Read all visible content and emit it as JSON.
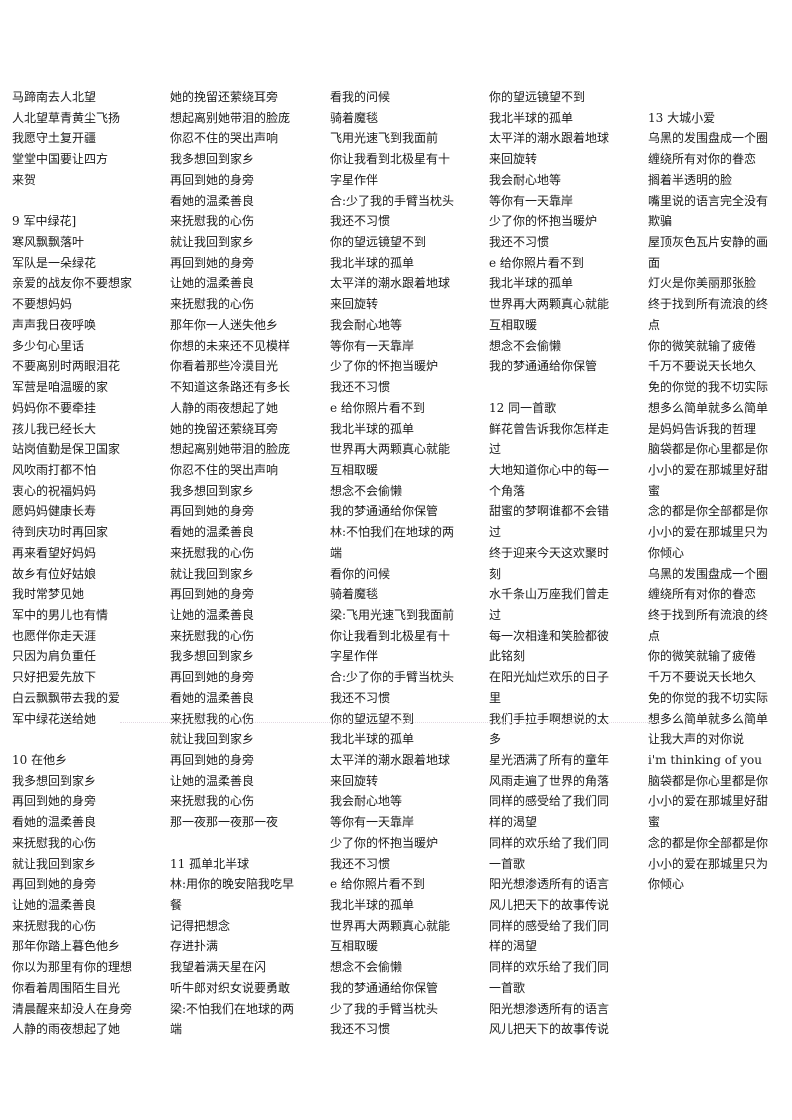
{
  "document": {
    "columns": [
      {
        "lines": [
          "马蹄南去人北望",
          "人北望草青黄尘飞扬",
          "我愿守土复开疆",
          "堂堂中国要让四方",
          "来贺",
          "",
          "9 军中绿花]",
          "寒风飘飘落叶",
          "军队是一朵绿花",
          "亲爱的战友你不要想家",
          "不要想妈妈",
          "声声我日夜呼唤",
          "多少句心里话",
          "不要离别时两眼泪花",
          "军营是咱温暖的家",
          "妈妈你不要牵挂",
          "孩儿我已经长大",
          "站岗值勤是保卫国家",
          "风吹雨打都不怕",
          "衷心的祝福妈妈",
          "愿妈妈健康长寿",
          "待到庆功时再回家",
          "再来看望好妈妈",
          "故乡有位好姑娘",
          "我时常梦见她",
          "军中的男儿也有情",
          "也愿伴你走天涯",
          "只因为肩负重任",
          "只好把爱先放下",
          "白云飘飘带去我的爱",
          "军中绿花送给她",
          "",
          "10 在他乡",
          "我多想回到家乡",
          "再回到她的身旁",
          "看她的温柔善良",
          "来抚慰我的心伤",
          "就让我回到家乡",
          "再回到她的身旁",
          "让她的温柔善良",
          "来抚慰我的心伤",
          "那年你踏上暮色他乡",
          "你以为那里有你的理想",
          "你看着周围陌生目光",
          "清晨醒来却没人在身旁",
          "人静的雨夜想起了她"
        ]
      },
      {
        "lines": [
          "她的挽留还萦绕耳旁",
          "想起离别她带泪的脸庞",
          "你忍不住的哭出声响",
          "我多想回到家乡",
          "再回到她的身旁",
          "看她的温柔善良",
          "来抚慰我的心伤",
          "就让我回到家乡",
          "再回到她的身旁",
          "让她的温柔善良",
          "来抚慰我的心伤",
          "那年你一人迷失他乡",
          "你想的未来还不见模样",
          "你看着那些冷漠目光",
          "不知道这条路还有多长",
          "人静的雨夜想起了她",
          "她的挽留还萦绕耳旁",
          "想起离别她带泪的脸庞",
          "你忍不住的哭出声响",
          "我多想回到家乡",
          "再回到她的身旁",
          "看她的温柔善良",
          "来抚慰我的心伤",
          "就让我回到家乡",
          "再回到她的身旁",
          "让她的温柔善良",
          "来抚慰我的心伤",
          "我多想回到家乡",
          "再回到她的身旁",
          "看她的温柔善良",
          "来抚慰我的心伤",
          "就让我回到家乡",
          "再回到她的身旁",
          "让她的温柔善良",
          "来抚慰我的心伤",
          "那一夜那一夜那一夜",
          "",
          "11 孤单北半球",
          "林:用你的晚安陪我吃早",
          "餐",
          "记得把想念",
          "存进扑满",
          "我望着满天星在闪",
          "听牛郎对织女说要勇敢",
          "梁:不怕我们在地球的两",
          "端"
        ]
      },
      {
        "lines": [
          "看我的问候",
          "骑着魔毯",
          "飞用光速飞到我面前",
          "你让我看到北极星有十",
          "字星作伴",
          "合:少了我的手臂当枕头",
          "我还不习惯",
          "你的望远镜望不到",
          "我北半球的孤单",
          "太平洋的潮水跟着地球",
          "来回旋转",
          "我会耐心地等",
          "等你有一天靠岸",
          "少了你的怀抱当暖炉",
          "我还不习惯",
          "e 给你照片看不到",
          "我北半球的孤单",
          "世界再大两颗真心就能",
          "互相取暖",
          "想念不会偷懒",
          "我的梦通通给你保管",
          "林:不怕我们在地球的两",
          "端",
          "看你的问候",
          "骑着魔毯",
          "梁:飞用光速飞到我面前",
          "你让我看到北极星有十",
          "字星作伴",
          "合:少了你的手臂当枕头",
          "我还不习惯",
          "你的望远望不到",
          "我北半球的孤单",
          "太平洋的潮水跟着地球",
          "来回旋转",
          "我会耐心地等",
          "等你有一天靠岸",
          "少了你的怀抱当暖炉",
          "我还不习惯",
          "e 给你照片看不到",
          "我北半球的孤单",
          "世界再大两颗真心就能",
          "互相取暖",
          "想念不会偷懒",
          "我的梦通通给你保管",
          "少了我的手臂当枕头",
          "我还不习惯"
        ]
      },
      {
        "lines": [
          "你的望远镜望不到",
          "我北半球的孤单",
          "太平洋的潮水跟着地球",
          "来回旋转",
          "我会耐心地等",
          "等你有一天靠岸",
          "少了你的怀抱当暖炉",
          "我还不习惯",
          "e 给你照片看不到",
          "我北半球的孤单",
          "世界再大两颗真心就能",
          "互相取暖",
          "想念不会偷懒",
          "我的梦通通给你保管",
          "",
          "12 同一首歌",
          "鲜花曾告诉我你怎样走",
          "过",
          "大地知道你心中的每一",
          "个角落",
          "甜蜜的梦啊谁都不会错",
          "过",
          "终于迎来今天这欢聚时",
          "刻",
          "水千条山万座我们曾走",
          "过",
          "每一次相逢和笑脸都彼",
          "此铭刻",
          "在阳光灿烂欢乐的日子",
          "里",
          "我们手拉手啊想说的太",
          "多",
          "星光洒满了所有的童年",
          "风雨走遍了世界的角落",
          "同样的感受给了我们同",
          "样的渴望",
          "同样的欢乐给了我们同",
          "一首歌",
          "阳光想渗透所有的语言",
          "风儿把天下的故事传说",
          "同样的感受给了我们同",
          "样的渴望",
          "同样的欢乐给了我们同",
          "一首歌",
          "阳光想渗透所有的语言",
          "风儿把天下的故事传说"
        ]
      },
      {
        "lines": [
          "",
          "13 大城小爱",
          "乌黑的发围盘成一个圈",
          "缠绕所有对你的眷恋",
          "搁着半透明的脸",
          "嘴里说的语言完全没有",
          "欺骗",
          "屋顶灰色瓦片安静的画",
          "面",
          "灯火是你美丽那张脸",
          "终于找到所有流浪的终",
          "点",
          "你的微笑就输了疲倦",
          "千万不要说天长地久",
          "免的你觉的我不切实际",
          "想多么简单就多么简单",
          "是妈妈告诉我的哲理",
          "脑袋都是你心里都是你",
          "小小的爱在那城里好甜",
          "蜜",
          "念的都是你全部都是你",
          "小小的爱在那城里只为",
          "你倾心",
          "乌黑的发围盘成一个圈",
          "缠绕所有对你的眷恋",
          "终于找到所有流浪的终",
          "点",
          "你的微笑就输了疲倦",
          "千万不要说天长地久",
          "免的你觉的我不切实际",
          "想多么简单就多么简单",
          "让我大声的对你说",
          "i'm thinking of you",
          "脑袋都是你心里都是你",
          "小小的爱在那城里好甜",
          "蜜",
          "念的都是你全部都是你",
          "小小的爱在那城里只为",
          "你倾心"
        ]
      }
    ]
  }
}
